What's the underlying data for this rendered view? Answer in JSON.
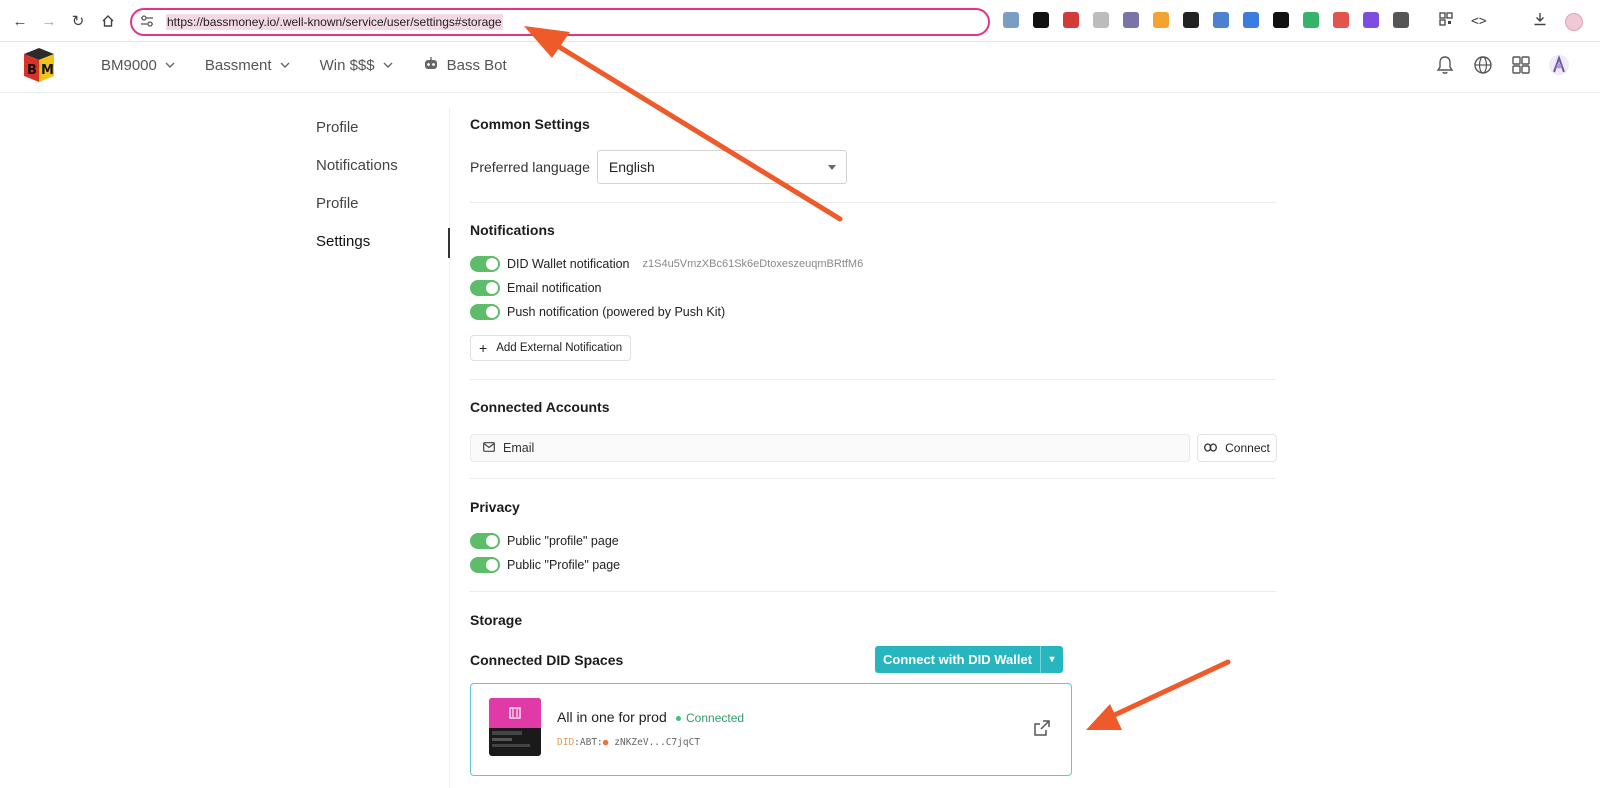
{
  "browser": {
    "url": "https://bassmoney.io/.well-known/service/user/settings#storage",
    "extensions": [
      {
        "icon": "rainbow-ext-icon",
        "color": "#7a9ec2"
      },
      {
        "icon": "triangle-ext-icon",
        "color": "#111111"
      },
      {
        "icon": "red-box-ext-icon",
        "color": "#d33a3a"
      },
      {
        "icon": "card-ext-icon",
        "color": "#bcbcbc"
      },
      {
        "icon": "fox-ext-icon",
        "color": "#7a73a8"
      },
      {
        "icon": "moon-ext-icon",
        "color": "#f3a430"
      },
      {
        "icon": "ring-ext-icon",
        "color": "#222222"
      },
      {
        "icon": "monitor-ext-icon",
        "color": "#4c80d0"
      },
      {
        "icon": "dollar-ext-icon",
        "color": "#3d7be0"
      },
      {
        "icon": "check-box-ext-icon",
        "color": "#111111"
      },
      {
        "icon": "shield-ext-icon",
        "color": "#36b26a"
      },
      {
        "icon": "yo-ext-icon",
        "color": "#e2544d"
      },
      {
        "icon": "d-ext-icon",
        "color": "#7d4de0"
      },
      {
        "icon": "puzzle-ext-icon",
        "color": "#555555"
      }
    ]
  },
  "header": {
    "nav": [
      {
        "label": "BM9000",
        "has_chevron": true
      },
      {
        "label": "Bassment",
        "has_chevron": true
      },
      {
        "label": "Win $$$",
        "has_chevron": true
      },
      {
        "label": "Bass Bot",
        "has_chevron": false
      }
    ]
  },
  "sidebar": {
    "items": [
      {
        "label": "Profile"
      },
      {
        "label": "Notifications"
      },
      {
        "label": "Profile"
      },
      {
        "label": "Settings",
        "active": true
      }
    ]
  },
  "common": {
    "title": "Common Settings",
    "language_label": "Preferred language",
    "language_value": "English"
  },
  "notifications": {
    "title": "Notifications",
    "did_wallet_label": "DID Wallet notification",
    "did_wallet_id": "z1S4u5VmzXBc61Sk6eDtoxeszeuqmBRtfM6",
    "email_label": "Email notification",
    "push_label": "Push notification (powered by Push Kit)",
    "add_external_label": "Add External Notification"
  },
  "connected_accounts": {
    "title": "Connected Accounts",
    "email_label": "Email",
    "connect_label": "Connect"
  },
  "privacy": {
    "title": "Privacy",
    "public_profile_1": "Public \"profile\" page",
    "public_profile_2": "Public \"Profile\" page"
  },
  "storage": {
    "title": "Storage",
    "spaces_title": "Connected DID Spaces",
    "connect_button": "Connect with DID Wallet",
    "space": {
      "name": "All in one for prod",
      "status": "Connected",
      "did_prefix": "DID",
      "did_rest": ":ABT:",
      "did_value": "zNKZeV...C7jqCT"
    }
  },
  "colors": {
    "accent": "#27b5c0",
    "toggle_on": "#5ebd6a",
    "url_highlight": "#e0338a",
    "arrow": "#ef5a2a"
  }
}
